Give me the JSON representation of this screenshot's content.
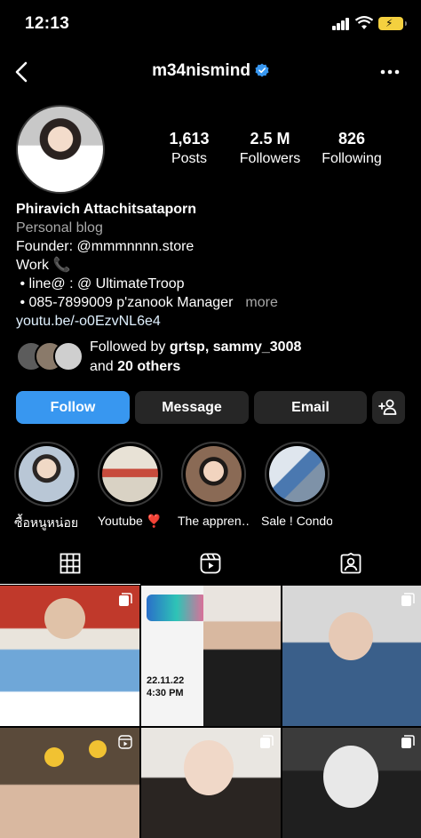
{
  "status_bar": {
    "time": "12:13"
  },
  "header": {
    "username": "m34nismind"
  },
  "stats": [
    {
      "value": "1,613",
      "label": "Posts"
    },
    {
      "value": "2.5 M",
      "label": "Followers"
    },
    {
      "value": "826",
      "label": "Following"
    }
  ],
  "bio": {
    "name": "Phiravich Attachitsataporn",
    "category": "Personal blog",
    "lines": [
      "Founder: @mmmnnnn.store",
      "Work 📞",
      " • line@ : @ UltimateTroop",
      " • 085-7899009 p'zanook Manager"
    ],
    "more": "more",
    "link": "youtu.be/-o0EzvNL6e4"
  },
  "followed_by": {
    "prefix": "Followed by ",
    "users": "grtsp, sammy_3008",
    "and": "and ",
    "others": "20 others"
  },
  "buttons": {
    "follow": "Follow",
    "message": "Message",
    "email": "Email"
  },
  "highlights": [
    {
      "label": "ซื้อหนูหน่อย",
      "color": "#b9c7d6"
    },
    {
      "label": "Youtube ❣️",
      "color": "#d9d2c4"
    },
    {
      "label": "The appren…",
      "color": "#8a6a55"
    },
    {
      "label": "Sale ! Condo",
      "color": "#7e92a8"
    }
  ],
  "tabs": [
    "grid-icon",
    "reels-icon",
    "tagged-icon"
  ],
  "posts": [
    {
      "icon": "carousel-icon",
      "colors": [
        "#c0392b",
        "#e9e4dc",
        "#6fa7d8"
      ]
    },
    {
      "icon": "none",
      "colors": [
        "#f2f2f2",
        "#ffffff",
        "#2c3e50"
      ],
      "overlay": "22.11.22 4:30 PM"
    },
    {
      "icon": "carousel-icon",
      "colors": [
        "#d7d7d7",
        "#3a5f8a",
        "#e6c9b5"
      ]
    },
    {
      "icon": "reel-icon",
      "colors": [
        "#5a4a3a",
        "#f1c232",
        "#d9b8a0"
      ]
    },
    {
      "icon": "carousel-icon",
      "colors": [
        "#e9e6e1",
        "#2a2522",
        "#f0d8c8"
      ]
    },
    {
      "icon": "carousel-icon",
      "colors": [
        "#3b3b3b",
        "#e8e8e8",
        "#1f1f1f"
      ]
    }
  ],
  "colors": {
    "follow": "#3897f0",
    "verified": "#3897f0",
    "battery": "#f4d03f"
  }
}
